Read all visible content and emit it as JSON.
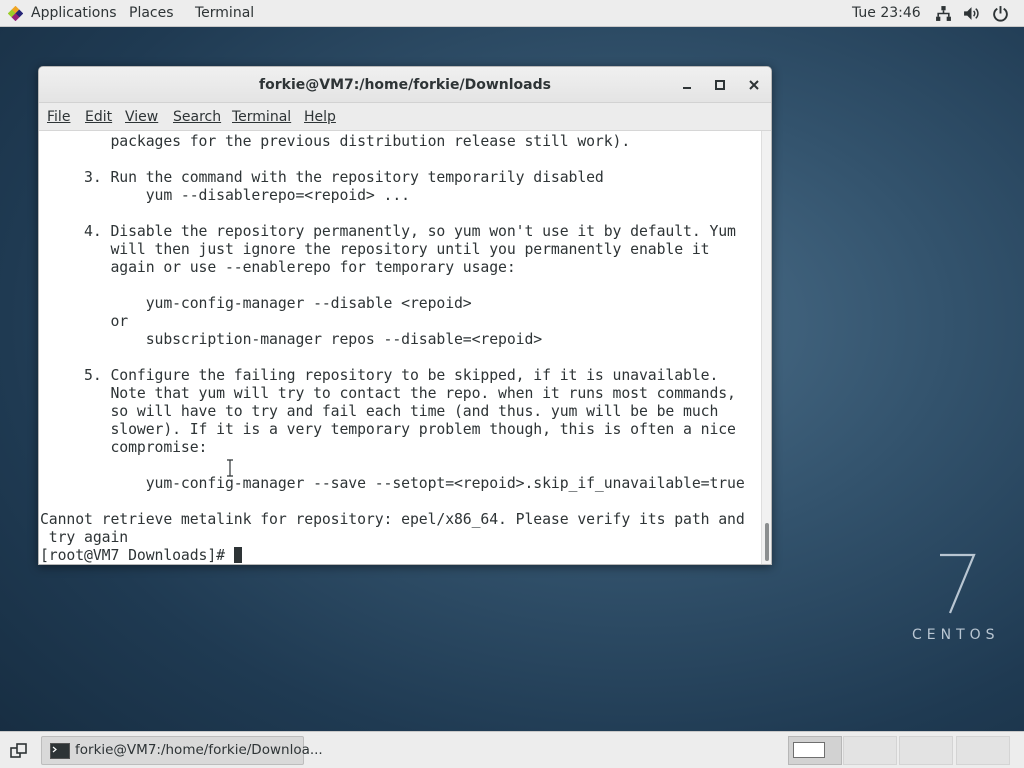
{
  "topbar": {
    "applications": "Applications",
    "places": "Places",
    "terminal": "Terminal",
    "clock": "Tue 23:46",
    "icons": [
      "network-icon",
      "volume-icon",
      "power-icon"
    ]
  },
  "window": {
    "title": "forkie@VM7:/home/forkie/Downloads",
    "menu": {
      "file": "File",
      "edit": "Edit",
      "view": "View",
      "search": "Search",
      "terminal": "Terminal",
      "help": "Help"
    }
  },
  "terminal": {
    "lines": [
      "        packages for the previous distribution release still work).",
      "",
      "     3. Run the command with the repository temporarily disabled",
      "            yum --disablerepo=<repoid> ...",
      "",
      "     4. Disable the repository permanently, so yum won't use it by default. Yum",
      "        will then just ignore the repository until you permanently enable it",
      "        again or use --enablerepo for temporary usage:",
      "",
      "            yum-config-manager --disable <repoid>",
      "        or",
      "            subscription-manager repos --disable=<repoid>",
      "",
      "     5. Configure the failing repository to be skipped, if it is unavailable.",
      "        Note that yum will try to contact the repo. when it runs most commands,",
      "        so will have to try and fail each time (and thus. yum will be be much",
      "        slower). If it is a very temporary problem though, this is often a nice",
      "        compromise:",
      "",
      "            yum-config-manager --save --setopt=<repoid>.skip_if_unavailable=true",
      "",
      "Cannot retrieve metalink for repository: epel/x86_64. Please verify its path and",
      " try again"
    ],
    "prompt": "[root@VM7 Downloads]# "
  },
  "watermark": {
    "number": "7",
    "word": "CENTOS"
  },
  "taskbar": {
    "window_label": "forkie@VM7:/home/forkie/Downloa...",
    "workspaces": 4,
    "active_workspace": 1
  },
  "colors": {
    "panel": "#ededed",
    "terminal_fg": "#2e3436",
    "desktop": "#2b4a64"
  }
}
